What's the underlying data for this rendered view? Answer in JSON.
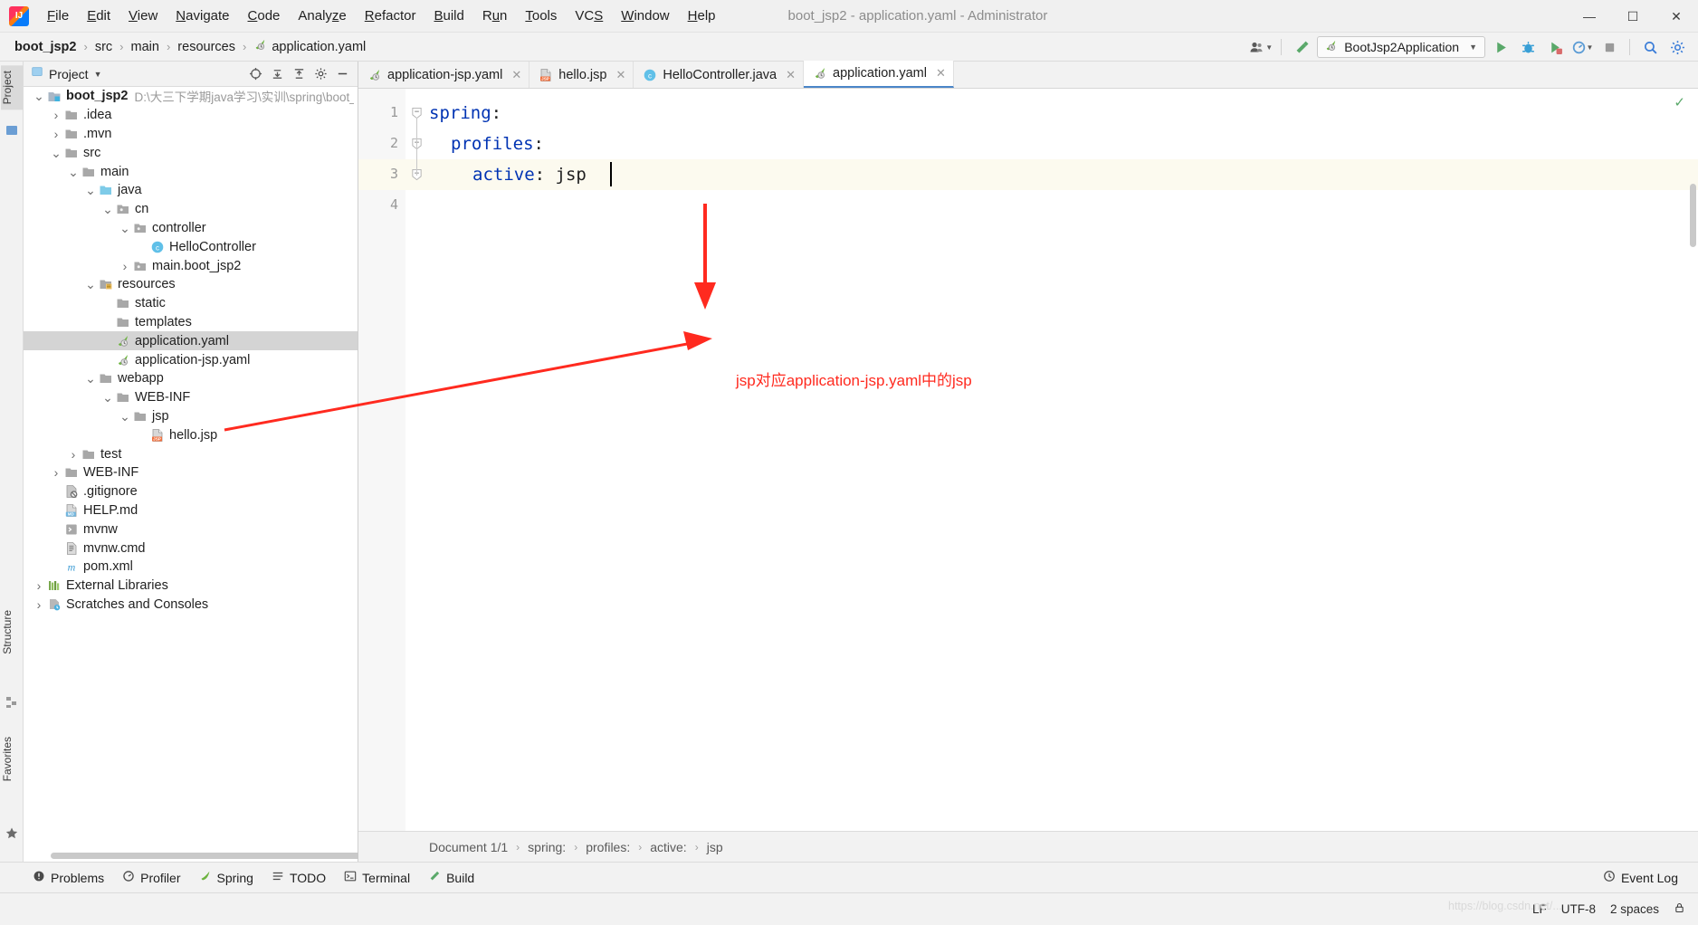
{
  "titlebar": {
    "logo": "intellij-logo",
    "window_title": "boot_jsp2 - application.yaml - Administrator",
    "minimize": "—",
    "maximize": "☐",
    "close": "✕",
    "menus": [
      {
        "label": "File",
        "mnemonic": "F"
      },
      {
        "label": "Edit",
        "mnemonic": "E"
      },
      {
        "label": "View",
        "mnemonic": "V"
      },
      {
        "label": "Navigate",
        "mnemonic": "N"
      },
      {
        "label": "Code",
        "mnemonic": "C"
      },
      {
        "label": "Analyze",
        "mnemonic": "z"
      },
      {
        "label": "Refactor",
        "mnemonic": "R"
      },
      {
        "label": "Build",
        "mnemonic": "B"
      },
      {
        "label": "Run",
        "mnemonic": "u"
      },
      {
        "label": "Tools",
        "mnemonic": "T"
      },
      {
        "label": "VCS",
        "mnemonic": "S"
      },
      {
        "label": "Window",
        "mnemonic": "W"
      },
      {
        "label": "Help",
        "mnemonic": "H"
      }
    ]
  },
  "navbar": {
    "breadcrumbs": [
      "boot_jsp2",
      "src",
      "main",
      "resources",
      "application.yaml"
    ],
    "separator": "›",
    "run_config": "BootJsp2Application",
    "run_config_caret": "▼",
    "icons": [
      "user-settings-icon",
      "build-hammer-icon",
      "run-icon",
      "debug-icon",
      "run-with-coverage-icon",
      "profile-icon",
      "stop-icon",
      "search-everywhere-icon",
      "settings-gear-icon"
    ]
  },
  "stripes": {
    "left_top": [
      "Project",
      "Structure"
    ],
    "left_bottom": [
      "Favorites"
    ]
  },
  "project_panel": {
    "title": "Project",
    "caret": "▼",
    "toolbar_icons": [
      "locate-icon",
      "expand-all-icon",
      "collapse-all-icon",
      "settings-gear-icon",
      "hide-icon"
    ],
    "tree": [
      {
        "depth": 0,
        "arrow": "open",
        "icon": "module-icon",
        "label": "boot_jsp2",
        "bold": true,
        "path": "D:\\大三下学期java学习\\实训\\spring\\boot_jsp",
        "selected": false
      },
      {
        "depth": 1,
        "arrow": "closed",
        "icon": "folder-icon",
        "label": ".idea",
        "selected": false
      },
      {
        "depth": 1,
        "arrow": "closed",
        "icon": "folder-icon",
        "label": ".mvn",
        "selected": false
      },
      {
        "depth": 1,
        "arrow": "open",
        "icon": "folder-icon",
        "label": "src",
        "selected": false
      },
      {
        "depth": 2,
        "arrow": "open",
        "icon": "folder-icon",
        "label": "main",
        "selected": false
      },
      {
        "depth": 3,
        "arrow": "open",
        "icon": "source-folder-icon",
        "label": "java",
        "selected": false
      },
      {
        "depth": 4,
        "arrow": "open",
        "icon": "package-icon",
        "label": "cn",
        "selected": false
      },
      {
        "depth": 5,
        "arrow": "open",
        "icon": "package-icon",
        "label": "controller",
        "selected": false
      },
      {
        "depth": 6,
        "arrow": "none",
        "icon": "java-class-icon",
        "label": "HelloController",
        "selected": false
      },
      {
        "depth": 5,
        "arrow": "closed",
        "icon": "package-icon",
        "label": "main.boot_jsp2",
        "selected": false
      },
      {
        "depth": 3,
        "arrow": "open",
        "icon": "resources-folder-icon",
        "label": "resources",
        "selected": false
      },
      {
        "depth": 4,
        "arrow": "none",
        "icon": "folder-icon",
        "label": "static",
        "selected": false
      },
      {
        "depth": 4,
        "arrow": "none",
        "icon": "folder-icon",
        "label": "templates",
        "selected": false
      },
      {
        "depth": 4,
        "arrow": "none",
        "icon": "spring-yaml-icon",
        "label": "application.yaml",
        "selected": true
      },
      {
        "depth": 4,
        "arrow": "none",
        "icon": "spring-yaml-icon",
        "label": "application-jsp.yaml",
        "selected": false
      },
      {
        "depth": 3,
        "arrow": "open",
        "icon": "folder-icon",
        "label": "webapp",
        "selected": false
      },
      {
        "depth": 4,
        "arrow": "open",
        "icon": "folder-icon",
        "label": "WEB-INF",
        "selected": false
      },
      {
        "depth": 5,
        "arrow": "open",
        "icon": "folder-icon",
        "label": "jsp",
        "selected": false
      },
      {
        "depth": 6,
        "arrow": "none",
        "icon": "jsp-file-icon",
        "label": "hello.jsp",
        "selected": false
      },
      {
        "depth": 2,
        "arrow": "closed",
        "icon": "folder-icon",
        "label": "test",
        "selected": false
      },
      {
        "depth": 1,
        "arrow": "closed",
        "icon": "folder-icon",
        "label": "WEB-INF",
        "selected": false
      },
      {
        "depth": 1,
        "arrow": "none",
        "icon": "gitignore-icon",
        "label": ".gitignore",
        "selected": false
      },
      {
        "depth": 1,
        "arrow": "none",
        "icon": "markdown-icon",
        "label": "HELP.md",
        "selected": false
      },
      {
        "depth": 1,
        "arrow": "none",
        "icon": "shell-script-icon",
        "label": "mvnw",
        "selected": false
      },
      {
        "depth": 1,
        "arrow": "none",
        "icon": "cmd-file-icon",
        "label": "mvnw.cmd",
        "selected": false
      },
      {
        "depth": 1,
        "arrow": "none",
        "icon": "maven-icon",
        "label": "pom.xml",
        "selected": false
      },
      {
        "depth": 0,
        "arrow": "closed",
        "icon": "external-libraries-icon",
        "label": "External Libraries",
        "selected": false
      },
      {
        "depth": 0,
        "arrow": "closed",
        "icon": "scratches-icon",
        "label": "Scratches and Consoles",
        "selected": false
      }
    ]
  },
  "editor": {
    "tabs": [
      {
        "label": "application-jsp.yaml",
        "icon": "spring-yaml-icon",
        "active": false,
        "close": "✕"
      },
      {
        "label": "hello.jsp",
        "icon": "jsp-file-icon",
        "active": false,
        "close": "✕"
      },
      {
        "label": "HelloController.java",
        "icon": "java-class-icon",
        "active": false,
        "close": "✕"
      },
      {
        "label": "application.yaml",
        "icon": "spring-yaml-icon",
        "active": true,
        "close": "✕"
      }
    ],
    "lines": [
      {
        "num": "1",
        "indent": 0,
        "key": "spring",
        "punc": ":",
        "value": "",
        "fold": "open",
        "current": false
      },
      {
        "num": "2",
        "indent": 1,
        "key": "profiles",
        "punc": ":",
        "value": "",
        "fold": "open",
        "current": false
      },
      {
        "num": "3",
        "indent": 2,
        "key": "active",
        "punc": ":",
        "value": " jsp",
        "fold": "leaf",
        "current": true
      },
      {
        "num": "4",
        "indent": 0,
        "key": "",
        "punc": "",
        "value": "",
        "fold": "none",
        "current": false
      }
    ],
    "inspection_status": "✓",
    "breadcrumbs": [
      "Document 1/1",
      "spring:",
      "profiles:",
      "active:",
      "jsp"
    ],
    "breadcrumb_sep": "›"
  },
  "annotation": {
    "text": "jsp对应application-jsp.yaml中的jsp",
    "color": "#ff2a1f"
  },
  "bottom_bar": {
    "items": [
      {
        "label": "Problems",
        "icon": "problems-icon"
      },
      {
        "label": "Profiler",
        "icon": "profiler-icon"
      },
      {
        "label": "Spring",
        "icon": "spring-icon"
      },
      {
        "label": "TODO",
        "icon": "todo-icon"
      },
      {
        "label": "Terminal",
        "icon": "terminal-icon"
      },
      {
        "label": "Build",
        "icon": "build-hammer-icon"
      }
    ],
    "event_log": "Event Log",
    "event_log_icon": "event-log-icon"
  },
  "status_bar": {
    "line_separator": "LF",
    "encoding": "UTF-8",
    "indent": "2 spaces",
    "lock_icon": "lock-icon",
    "watermark": "https://blog.csdn.net/..."
  }
}
